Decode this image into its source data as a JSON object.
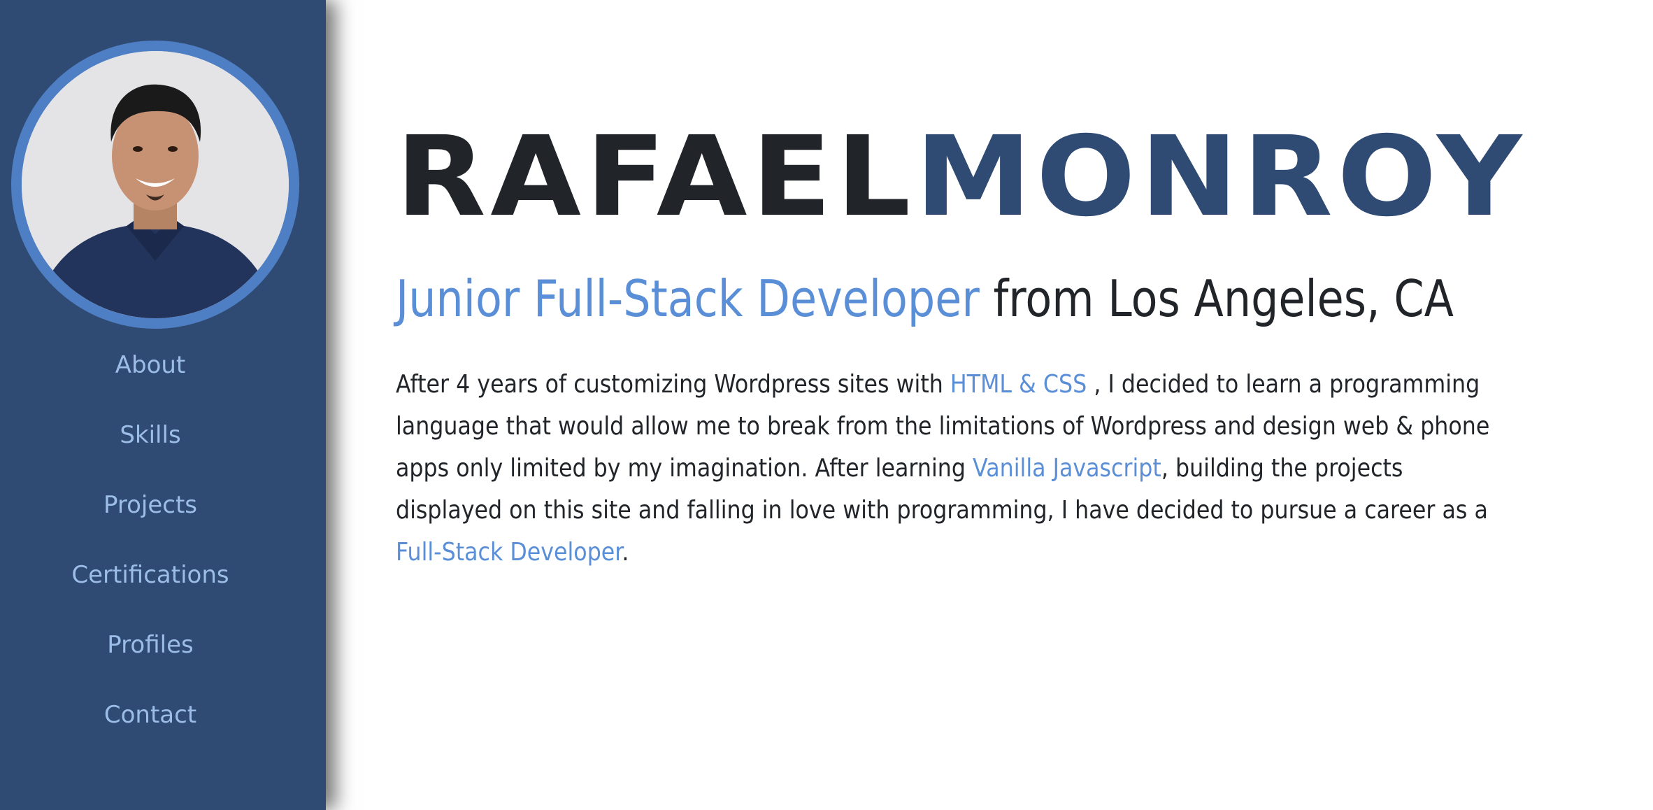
{
  "sidebar": {
    "nav": [
      {
        "label": "About"
      },
      {
        "label": "Skills"
      },
      {
        "label": "Projects"
      },
      {
        "label": "Certifications"
      },
      {
        "label": "Profiles"
      },
      {
        "label": "Contact"
      }
    ]
  },
  "hero": {
    "first_name": "RAFAEL",
    "last_name": "MONROY",
    "role": "Junior Full-Stack Developer",
    "location": " from Los Angeles, CA"
  },
  "bio": {
    "p1": "After 4 years of customizing Wordpress sites with ",
    "link1": "HTML & CSS",
    "p2": " , I decided to learn a programming language that would allow me to break from the limitations of Wordpress and design web & phone apps only limited by my imagination. After learning ",
    "link2": "Vanilla Javascript",
    "p3": ", building the projects displayed on this site and falling in love with programming, I have decided to pursue a career as a ",
    "link3": "Full-Stack Developer",
    "p4": "."
  },
  "colors": {
    "sidebar_bg": "#2f4b74",
    "accent": "#5a8fd8",
    "nav_text": "#9cbde7",
    "dark_text": "#212529"
  }
}
